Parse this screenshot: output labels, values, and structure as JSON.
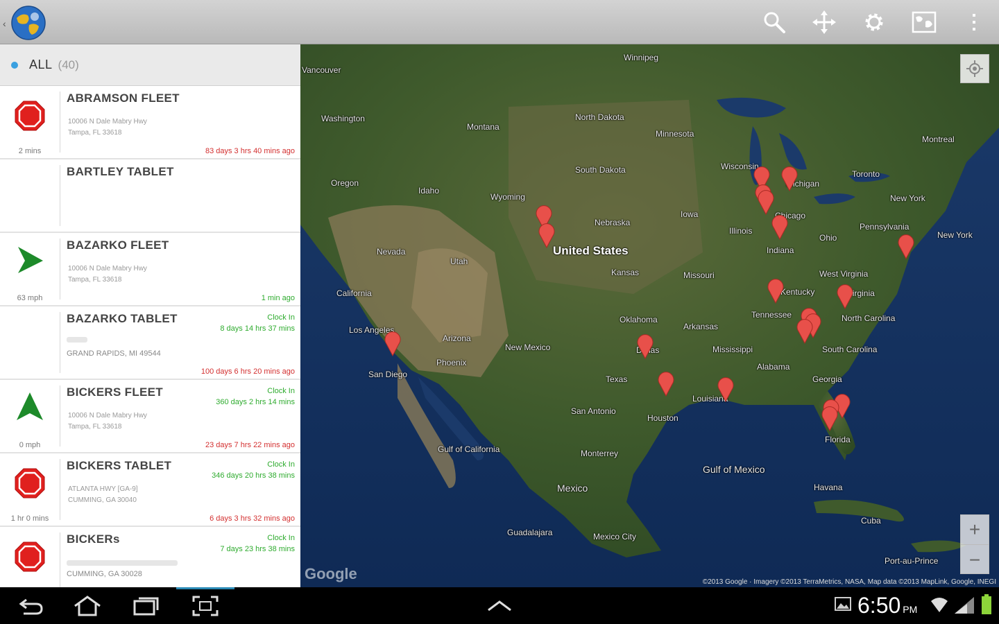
{
  "action_bar": {
    "icons": [
      "app-logo-icon",
      "search-icon",
      "center-map-icon",
      "settings-icon",
      "map-type-icon",
      "overflow-menu-icon"
    ]
  },
  "list": {
    "header": {
      "title": "ALL",
      "count": "(40)"
    },
    "rows": [
      {
        "name": "ABRAMSON FLEET",
        "icon": "stopped-icon",
        "speed": "2 mins",
        "address1": "10006 N Dale Mabry Hwy",
        "address2": "Tampa, FL 33618",
        "ago": "83 days 3 hrs 40 mins ago",
        "ago_color": "#d32f2f"
      },
      {
        "name": "BARTLEY TABLET",
        "icon": "",
        "speed": "",
        "address1": "",
        "address2": "",
        "ago": ""
      },
      {
        "name": "BAZARKO FLEET",
        "icon": "moving-arrow-icon",
        "speed": "63 mph",
        "address1": "10006 N Dale Mabry Hwy",
        "address2": "Tampa, FL 33618",
        "ago": "1 min ago",
        "ago_color": "#2eab2e"
      },
      {
        "name": "BAZARKO TABLET",
        "icon": "",
        "speed": "",
        "address1": "",
        "address2": "GRAND RAPIDS, MI 49544",
        "clock_label": "Clock In",
        "clock_value": "8 days 14 hrs 37 mins",
        "ago": "100 days 6 hrs 20 mins ago",
        "ago_color": "#d32f2f"
      },
      {
        "name": "BICKERS FLEET",
        "icon": "north-arrow-icon",
        "speed": "0 mph",
        "address1": "10006 N Dale Mabry Hwy",
        "address2": "Tampa, FL 33618",
        "clock_label": "Clock In",
        "clock_value": "360 days 2 hrs 14 mins",
        "ago": "23 days 7 hrs 22 mins ago",
        "ago_color": "#d32f2f"
      },
      {
        "name": "BICKERS TABLET",
        "icon": "stopped-icon",
        "speed": "1 hr 0 mins",
        "address1": "ATLANTA HWY [GA-9]",
        "address2": "CUMMING, GA 30040",
        "clock_label": "Clock In",
        "clock_value": "346 days 20 hrs 38 mins",
        "ago": "6 days 3 hrs 32 mins ago",
        "ago_color": "#d32f2f"
      },
      {
        "name": "BICKERs",
        "icon": "stopped-icon",
        "speed": "",
        "address1": "",
        "address2": "CUMMING, GA 30028",
        "clock_label": "Clock In",
        "clock_value": "7 days 23 hrs 38 mins",
        "ago": ""
      }
    ]
  },
  "map": {
    "labels": [
      {
        "text": "Winnipeg",
        "cls": ""
      },
      {
        "text": "Vancouver",
        "cls": ""
      },
      {
        "text": "Washington",
        "cls": ""
      },
      {
        "text": "Montana",
        "cls": ""
      },
      {
        "text": "North Dakota",
        "cls": ""
      },
      {
        "text": "Minnesota",
        "cls": ""
      },
      {
        "text": "Montreal",
        "cls": ""
      },
      {
        "text": "Oregon",
        "cls": ""
      },
      {
        "text": "Idaho",
        "cls": ""
      },
      {
        "text": "Wyoming",
        "cls": ""
      },
      {
        "text": "South Dakota",
        "cls": ""
      },
      {
        "text": "Wisconsin",
        "cls": ""
      },
      {
        "text": "Michigan",
        "cls": ""
      },
      {
        "text": "Toronto",
        "cls": ""
      },
      {
        "text": "New York",
        "cls": ""
      },
      {
        "text": "Nebraska",
        "cls": ""
      },
      {
        "text": "Iowa",
        "cls": ""
      },
      {
        "text": "Chicago",
        "cls": ""
      },
      {
        "text": "Illinois",
        "cls": ""
      },
      {
        "text": "Ohio",
        "cls": ""
      },
      {
        "text": "Pennsylvania",
        "cls": ""
      },
      {
        "text": "New York",
        "cls": ""
      },
      {
        "text": "Nevada",
        "cls": ""
      },
      {
        "text": "Utah",
        "cls": ""
      },
      {
        "text": "United States",
        "cls": "big"
      },
      {
        "text": "Indiana",
        "cls": ""
      },
      {
        "text": "Kansas",
        "cls": ""
      },
      {
        "text": "Missouri",
        "cls": ""
      },
      {
        "text": "West Virginia",
        "cls": ""
      },
      {
        "text": "California",
        "cls": ""
      },
      {
        "text": "Kentucky",
        "cls": ""
      },
      {
        "text": "Virginia",
        "cls": ""
      },
      {
        "text": "Tennessee",
        "cls": ""
      },
      {
        "text": "North Carolina",
        "cls": ""
      },
      {
        "text": "Oklahoma",
        "cls": ""
      },
      {
        "text": "Arkansas",
        "cls": ""
      },
      {
        "text": "Los Angeles",
        "cls": ""
      },
      {
        "text": "Arizona",
        "cls": ""
      },
      {
        "text": "New Mexico",
        "cls": ""
      },
      {
        "text": "Mississippi",
        "cls": ""
      },
      {
        "text": "South Carolina",
        "cls": ""
      },
      {
        "text": "Phoenix",
        "cls": ""
      },
      {
        "text": "Dallas",
        "cls": ""
      },
      {
        "text": "Alabama",
        "cls": ""
      },
      {
        "text": "San Diego",
        "cls": ""
      },
      {
        "text": "Texas",
        "cls": ""
      },
      {
        "text": "Georgia",
        "cls": ""
      },
      {
        "text": "Louisiana",
        "cls": ""
      },
      {
        "text": "San Antonio",
        "cls": ""
      },
      {
        "text": "Houston",
        "cls": ""
      },
      {
        "text": "Florida",
        "cls": ""
      },
      {
        "text": "Gulf of California",
        "cls": ""
      },
      {
        "text": "Monterrey",
        "cls": ""
      },
      {
        "text": "Gulf of Mexico",
        "cls": "mid"
      },
      {
        "text": "Mexico",
        "cls": "mid"
      },
      {
        "text": "Havana",
        "cls": ""
      },
      {
        "text": "Cuba",
        "cls": ""
      },
      {
        "text": "Guadalajara",
        "cls": ""
      },
      {
        "text": "Mexico City",
        "cls": ""
      },
      {
        "text": "Port-au-Prince",
        "cls": ""
      }
    ],
    "google_logo": "Google",
    "attribution": "©2013 Google · Imagery ©2013 TerraMetrics, NASA, Map data ©2013 MapLink, Google, INEGI",
    "zoom_in": "+",
    "zoom_out": "−"
  },
  "system_bar": {
    "time": "6:50",
    "ampm": "PM",
    "icons": [
      "back-icon",
      "home-icon",
      "recent-apps-icon",
      "screenshot-icon",
      "up-chevron-icon",
      "gallery-notification-icon",
      "wifi-icon",
      "signal-icon",
      "battery-icon"
    ]
  }
}
